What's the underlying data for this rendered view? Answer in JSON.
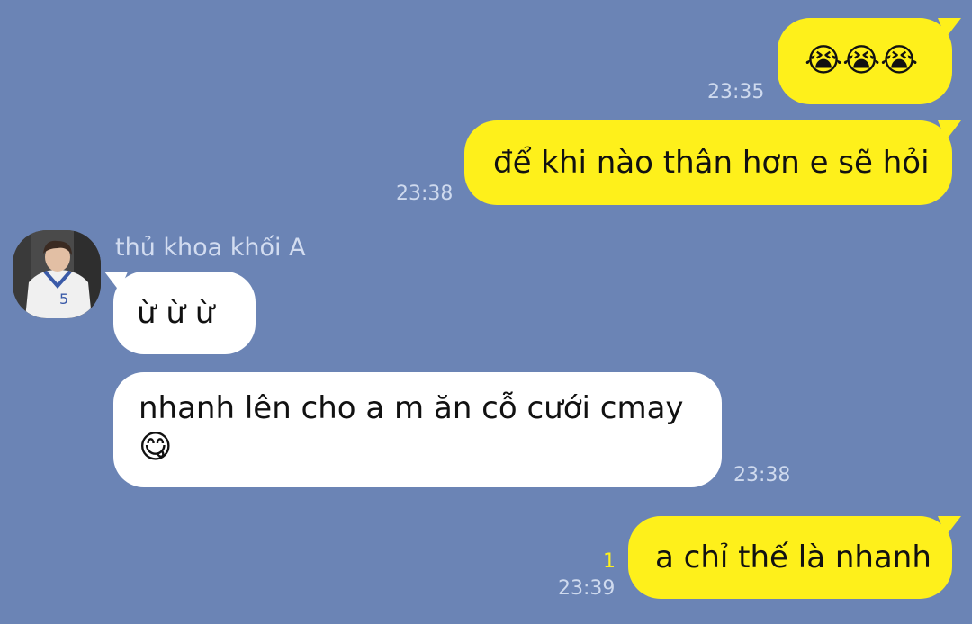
{
  "contact": {
    "name": "thủ khoa khối A"
  },
  "messages": [
    {
      "side": "me",
      "text": "😭😭😭",
      "time": "23:35"
    },
    {
      "side": "me",
      "text": "để khi nào thân hơn e sẽ hỏi",
      "time": "23:38"
    },
    {
      "side": "them",
      "text": "ừ ừ ừ"
    },
    {
      "side": "them",
      "line1": "nhanh lên cho a m ăn cỗ cưới cmay",
      "line2": "😋",
      "time": "23:38"
    },
    {
      "side": "me",
      "text": "a chỉ thế là nhanh",
      "time": "23:39",
      "unread": "1"
    }
  ],
  "colors": {
    "background": "#6b84b5",
    "my_bubble": "#fef01b",
    "their_bubble": "#ffffff",
    "text": "#111111"
  }
}
